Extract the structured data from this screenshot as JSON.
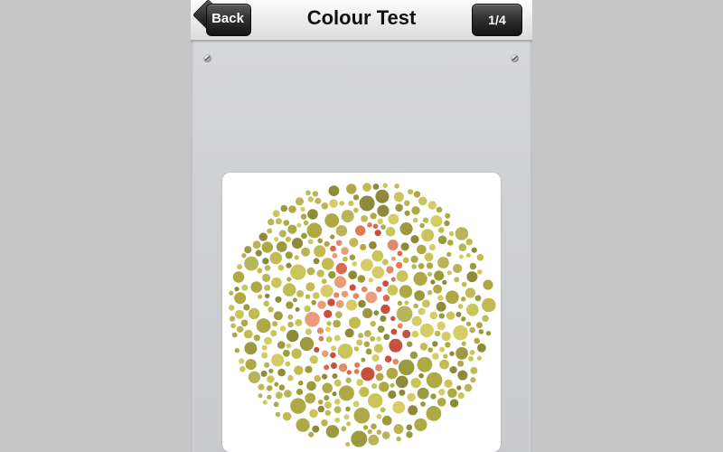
{
  "navbar": {
    "title": "Colour Test",
    "back_label": "Back",
    "page_indicator": "1/4"
  },
  "plate": {
    "icon": "ishihara-plate",
    "hidden_figure": "8",
    "background_colors": [
      "#9c9a3e",
      "#c9c55b",
      "#aea845",
      "#b8b45a",
      "#d6cc66",
      "#8d8a3a",
      "#c2bb52"
    ],
    "figure_colors": [
      "#e08a6a",
      "#d66a52",
      "#c9503e",
      "#ea9c78",
      "#de7a58"
    ]
  }
}
